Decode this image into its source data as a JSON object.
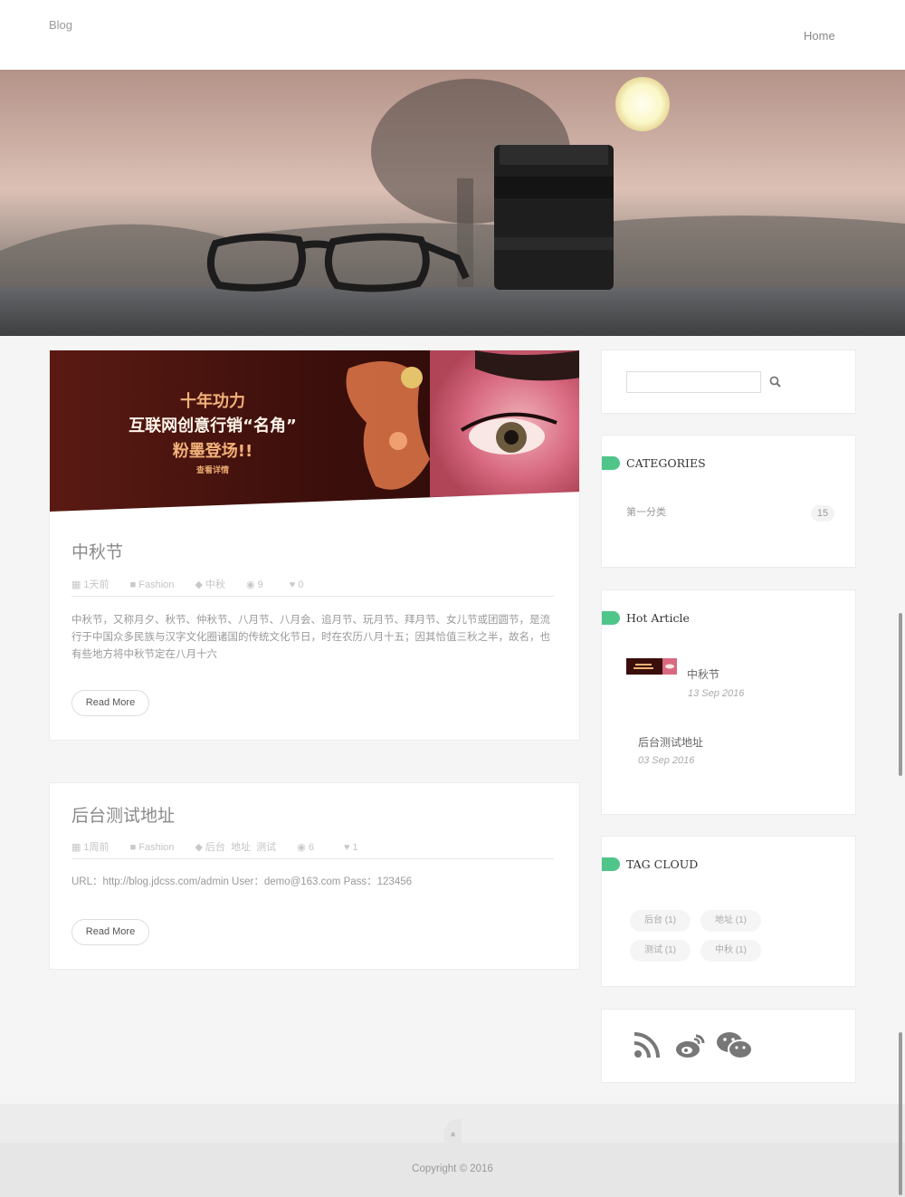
{
  "header": {
    "brand": "Blog",
    "nav": {
      "home": "Home"
    }
  },
  "posts": [
    {
      "banner_text": {
        "line1": "十年功力",
        "line2": "互联网创意行销“名角”",
        "line3": "粉墨登场!!",
        "line4": "查看详情"
      },
      "title": "中秋节",
      "meta": {
        "time": "1天前",
        "category": "Fashion",
        "tags": "中秋",
        "views": "9",
        "likes": "0"
      },
      "excerpt": "中秋节，又称月夕、秋节、仲秋节、八月节、八月会、追月节、玩月节、拜月节、女儿节或团圆节，是流行于中国众多民族与汉字文化圈诸国的传统文化节日，时在农历八月十五；因其恰值三秋之半，故名，也有些地方将中秋节定在八月十六",
      "read_more": "Read More"
    },
    {
      "title": "后台测试地址",
      "meta": {
        "time": "1周前",
        "category": "Fashion",
        "tags": "后台  地址  测试",
        "views": "6",
        "likes": "1"
      },
      "excerpt": "URL：http://blog.jdcss.com/admin User：demo@163.com Pass：123456",
      "read_more": "Read More"
    }
  ],
  "sidebar": {
    "search": {
      "placeholder": ""
    },
    "categories": {
      "title": "CATEGORIES",
      "items": [
        {
          "name": "第一分类",
          "count": "15"
        }
      ]
    },
    "hot": {
      "title": "Hot Article",
      "items": [
        {
          "title": "中秋节",
          "date": "13 Sep 2016"
        },
        {
          "title": "后台测试地址",
          "date": "03 Sep 2016"
        }
      ]
    },
    "tags": {
      "title": "TAG CLOUD",
      "items": [
        "后台 (1)",
        "地址 (1)",
        "测试 (1)",
        "中秋 (1)"
      ]
    },
    "social": [
      "rss-icon",
      "weibo-icon",
      "wechat-icon"
    ]
  },
  "footer": {
    "copyright": "Copyright © 2016",
    "to_top": "»"
  },
  "colors": {
    "accent": "#4fc589",
    "background": "#f5f5f5"
  }
}
